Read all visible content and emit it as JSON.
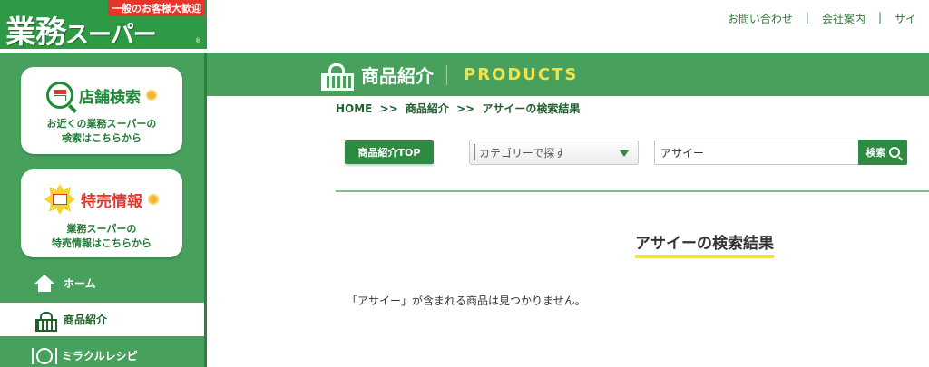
{
  "logo": {
    "tagline": "一般のお客様大歓迎",
    "name_main": "業務",
    "name_sub": "スーパー",
    "registered": "®"
  },
  "topnav": {
    "links": [
      "お問い合わせ",
      "会社案内",
      "サイ"
    ],
    "separator": "|"
  },
  "sidebar": {
    "store_search": {
      "title": "店舗検索",
      "line1": "お近くの業務スーパーの",
      "line2": "検索はこちらから"
    },
    "sale_info": {
      "title": "特売情報",
      "line1": "業務スーパーの",
      "line2": "特売情報はこちらから"
    },
    "menu": [
      {
        "label": "ホーム",
        "icon": "house-icon"
      },
      {
        "label": "商品紹介",
        "icon": "basket-icon",
        "active": true
      },
      {
        "label": "ミラクルレシピ",
        "icon": "plate-icon"
      }
    ]
  },
  "banner": {
    "title": "商品紹介",
    "title_en": "PRODUCTS"
  },
  "breadcrumb": {
    "items": [
      "HOME",
      "商品紹介",
      "アサイーの検索結果"
    ],
    "separator": ">>"
  },
  "search": {
    "top_button": "商品紹介TOP",
    "category_placeholder": "カテゴリーで探す",
    "query": "アサイー",
    "button": "検索"
  },
  "result": {
    "heading": "アサイーの検索結果",
    "message": "「アサイー」が含まれる商品は見つかりません。"
  },
  "colors": {
    "brand_green": "#47a05b",
    "dark_green": "#2f8a42",
    "accent_yellow": "#f3e147",
    "accent_red": "#e8352c"
  }
}
